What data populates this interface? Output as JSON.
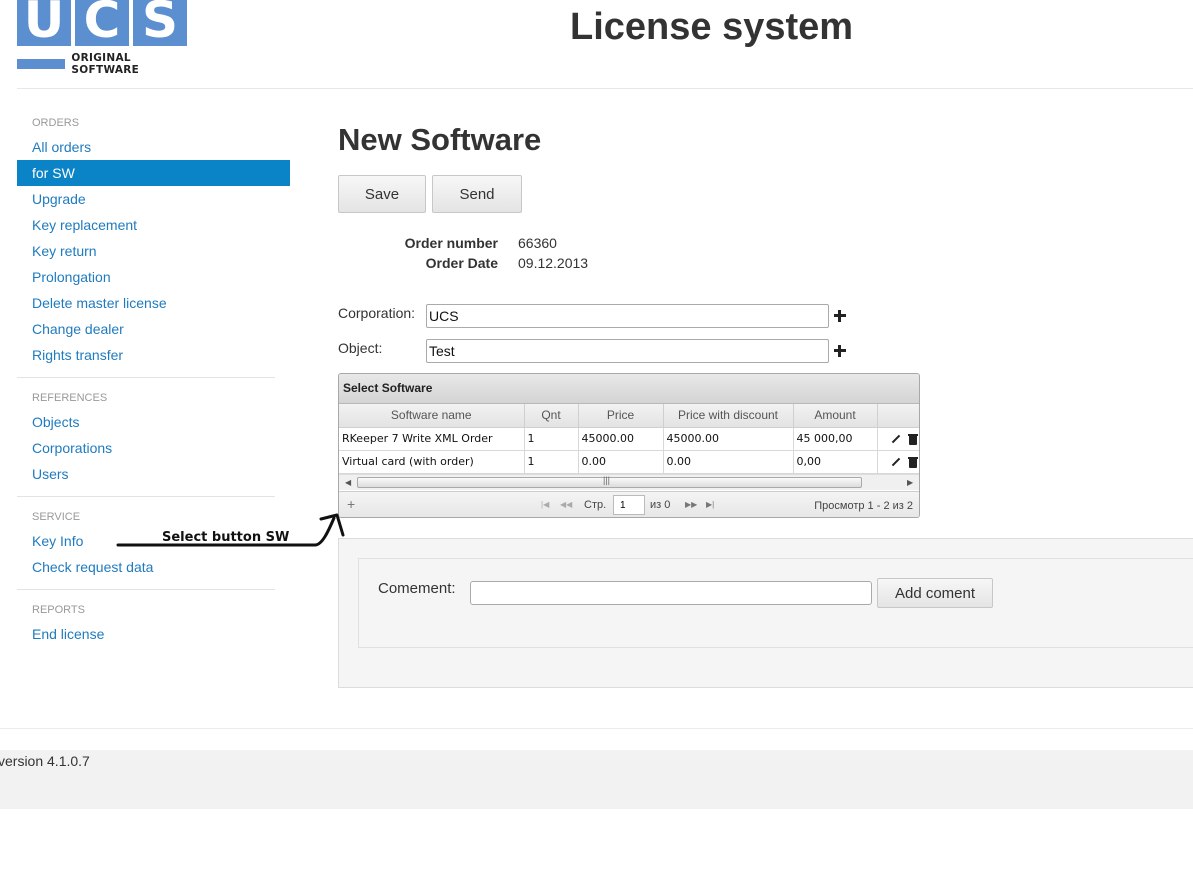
{
  "header": {
    "logo_letters": [
      "U",
      "C",
      "S"
    ],
    "logo_subtitle": "ORIGINAL SOFTWARE",
    "app_title": "License system"
  },
  "sidebar": {
    "sections": [
      {
        "title": "ORDERS",
        "items": [
          {
            "label": "All orders",
            "active": false
          },
          {
            "label": "for SW",
            "active": true
          },
          {
            "label": "Upgrade",
            "active": false
          },
          {
            "label": "Key replacement",
            "active": false
          },
          {
            "label": "Key return",
            "active": false
          },
          {
            "label": "Prolongation",
            "active": false
          },
          {
            "label": "Delete master license",
            "active": false
          },
          {
            "label": "Change dealer",
            "active": false
          },
          {
            "label": "Rights transfer",
            "active": false
          }
        ]
      },
      {
        "title": "REFERENCES",
        "items": [
          {
            "label": "Objects",
            "active": false
          },
          {
            "label": "Corporations",
            "active": false
          },
          {
            "label": "Users",
            "active": false
          }
        ]
      },
      {
        "title": "SERVICE",
        "items": [
          {
            "label": "Key Info",
            "active": false
          },
          {
            "label": "Check request data",
            "active": false
          }
        ]
      },
      {
        "title": "REPORTS",
        "items": [
          {
            "label": "End license",
            "active": false
          }
        ]
      }
    ]
  },
  "main": {
    "title": "New Software",
    "save_label": "Save",
    "send_label": "Send",
    "order_number_label": "Order number",
    "order_number": "66360",
    "order_date_label": "Order Date",
    "order_date": "09.12.2013",
    "corporation_label": "Corporation:",
    "corporation_value": "UCS",
    "object_label": "Object:",
    "object_value": "Test"
  },
  "grid": {
    "caption": "Select Software",
    "columns": [
      "Software name",
      "Qnt",
      "Price",
      "Price with discount",
      "Amount",
      ""
    ],
    "rows": [
      [
        "RKeeper 7 Write XML Order",
        "1",
        "45000.00",
        "45000.00",
        "45 000,00"
      ],
      [
        "Virtual card (with order)",
        "1",
        "0.00",
        "0.00",
        "0,00"
      ]
    ],
    "pager": {
      "page_label": "Стр.",
      "page_value": "1",
      "of_label": "из 0",
      "view_label": "Просмотр 1 - 2 из 2"
    }
  },
  "annotation": {
    "text": "Select button SW"
  },
  "comment": {
    "label": "Comement:",
    "value": "",
    "button_label": "Add coment"
  },
  "footer": {
    "version": "version 4.1.0.7"
  },
  "colors": {
    "brand_blue": "#5b8fd0",
    "active_nav": "#0a84c6",
    "link": "#1f7bbf"
  }
}
